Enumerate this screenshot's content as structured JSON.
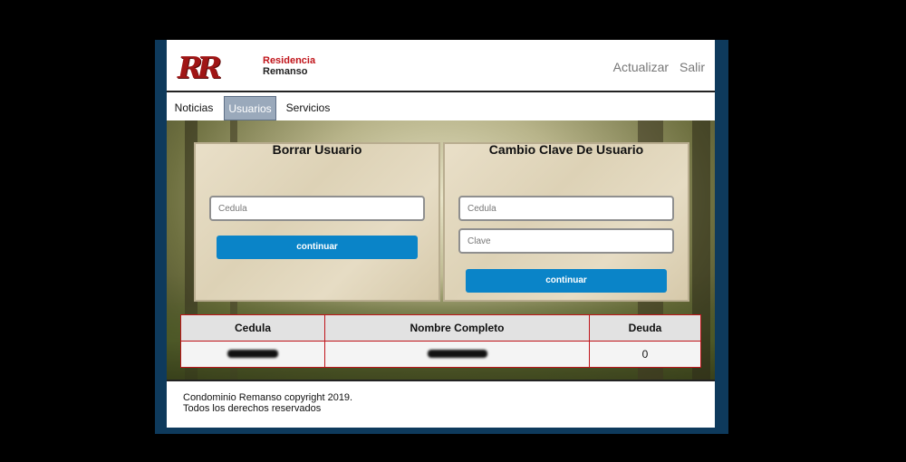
{
  "header": {
    "logo": {
      "mark": "RR",
      "line1": "Residencia",
      "line2": "Remanso"
    },
    "links": {
      "refresh": "Actualizar",
      "logout": "Salir"
    }
  },
  "nav": {
    "items": [
      "Noticias",
      "Usuarios",
      "Servicios"
    ],
    "active": "Usuarios"
  },
  "panels": {
    "delete_user": {
      "title": "Borrar Usuario",
      "cedula_placeholder": "Cedula",
      "button": "continuar"
    },
    "change_password": {
      "title": "Cambio Clave De Usuario",
      "cedula_placeholder": "Cedula",
      "clave_placeholder": "Clave",
      "button": "continuar"
    }
  },
  "table": {
    "headers": [
      "Cedula",
      "Nombre Completo",
      "Deuda"
    ],
    "rows": [
      {
        "cedula": "",
        "nombre": "",
        "deuda": "0"
      }
    ]
  },
  "footer": {
    "line1": "Condominio Remanso copyright 2019.",
    "line2": "Todos los derechos reservados"
  },
  "colors": {
    "accent": "#0a84c8",
    "brand": "#c0141a",
    "frame": "#0e3a5c"
  }
}
